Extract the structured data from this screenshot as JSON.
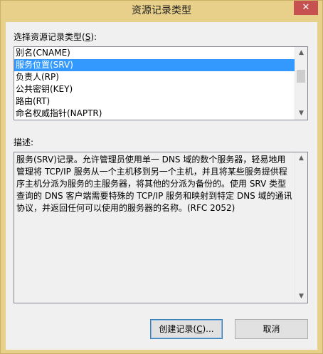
{
  "window": {
    "title": "资源记录类型",
    "close_glyph": "✕"
  },
  "type_label": {
    "prefix": "选择资源记录类型(",
    "key": "S",
    "suffix": "):"
  },
  "record_types": {
    "items": [
      "别名(CNAME)",
      "服务位置(SRV)",
      "负责人(RP)",
      "公共密钥(KEY)",
      "路由(RT)",
      "命名权威指针(NAPTR)"
    ],
    "selected_index": 1
  },
  "description": {
    "label": "描述:",
    "text": "服务(SRV)记录。允许管理员使用单一 DNS 域的数个服务器，轻易地用管理将 TCP/IP 服务从一个主机移到另一个主机，并且将某些服务提供程序主机分派为服务的主服务器，将其他的分派为备份的。使用 SRV 类型查询的 DNS 客户端需要特殊的 TCP/IP 服务和映射到特定 DNS 域的通讯协议，并返回任何可以使用的服务器的名称。(RFC 2052)"
  },
  "buttons": {
    "create_prefix": "创建记录(",
    "create_key": "C",
    "create_suffix": ")...",
    "cancel": "取消"
  },
  "scroll_glyphs": {
    "up": "▲",
    "down": "▼"
  },
  "colors": {
    "title_bar": "#e8d08a",
    "selection": "#3399ff",
    "close_button": "#c75050"
  }
}
